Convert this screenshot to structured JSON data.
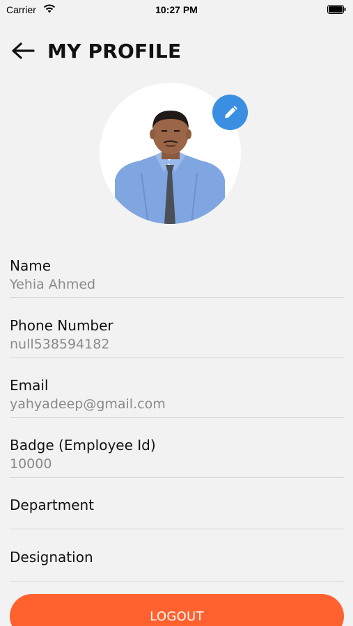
{
  "status_bar": {
    "carrier": "Carrier",
    "time": "10:27 PM"
  },
  "header": {
    "title": "MY PROFILE",
    "back_icon": "arrow-left-icon"
  },
  "profile": {
    "edit_icon": "pencil-icon",
    "accent": "#3a8fe2"
  },
  "fields": [
    {
      "label": "Name",
      "value": "Yehia Ahmed"
    },
    {
      "label": "Phone Number",
      "value": "null538594182"
    },
    {
      "label": "Email",
      "value": "yahyadeep@gmail.com"
    },
    {
      "label": "Badge (Employee Id)",
      "value": "10000"
    },
    {
      "label": "Department",
      "value": ""
    },
    {
      "label": "Designation",
      "value": ""
    }
  ],
  "logout": {
    "label": "LOGOUT",
    "color": "#ff622f"
  }
}
